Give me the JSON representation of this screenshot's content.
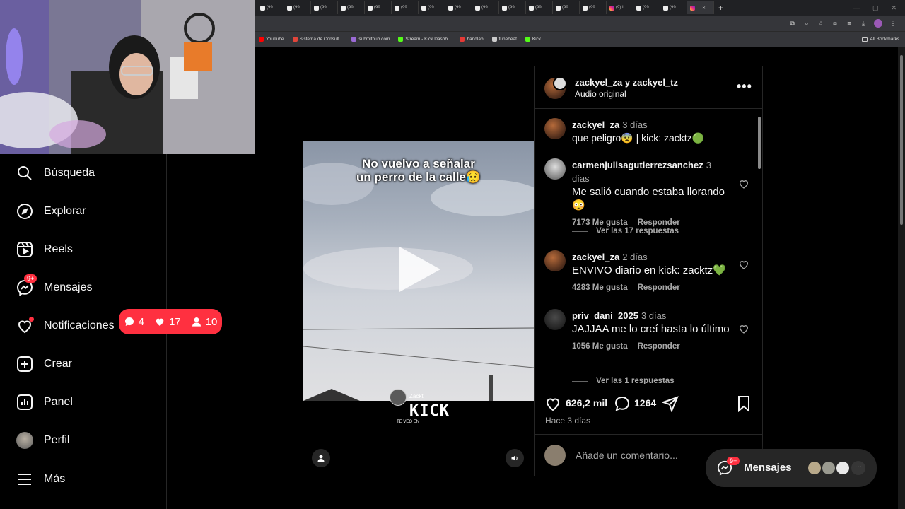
{
  "browser": {
    "tabs": [
      {
        "label": "(99",
        "icon": "tiktok"
      },
      {
        "label": "(99",
        "icon": "tiktok"
      },
      {
        "label": "(99",
        "icon": "tiktok"
      },
      {
        "label": "(99",
        "icon": "tiktok"
      },
      {
        "label": "(99",
        "icon": "tiktok"
      },
      {
        "label": "(99",
        "icon": "tiktok"
      },
      {
        "label": "(99",
        "icon": "tiktok"
      },
      {
        "label": "(99",
        "icon": "tiktok"
      },
      {
        "label": "(99",
        "icon": "tiktok"
      },
      {
        "label": "(99",
        "icon": "tiktok"
      },
      {
        "label": "(99",
        "icon": "tiktok"
      },
      {
        "label": "(99",
        "icon": "tiktok"
      },
      {
        "label": "(99",
        "icon": "tiktok"
      },
      {
        "label": "(9) I",
        "icon": "instagram"
      },
      {
        "label": "(99",
        "icon": "tiktok"
      },
      {
        "label": "(99",
        "icon": "tiktok"
      },
      {
        "label": "",
        "icon": "instagram",
        "active": true
      }
    ],
    "bookmarks": [
      "YouTube",
      "Sistema de Consult...",
      "submithub.com",
      "Stream - Kick Dashb...",
      "bandlab",
      "tunebeat",
      "Kick"
    ],
    "bookmark_colors": [
      "#ff0000",
      "#e0453a",
      "#9b6bd6",
      "#53fc18",
      "#e53935",
      "#cccccc",
      "#53fc18"
    ],
    "all_bookmarks": "All Bookmarks"
  },
  "sidebar": {
    "items": [
      {
        "label": "Búsqueda",
        "icon": "search-icon"
      },
      {
        "label": "Explorar",
        "icon": "compass-icon"
      },
      {
        "label": "Reels",
        "icon": "reels-icon"
      },
      {
        "label": "Mensajes",
        "icon": "messenger-icon",
        "badge": "9+"
      },
      {
        "label": "Notificaciones",
        "icon": "heart-icon"
      },
      {
        "label": "Crear",
        "icon": "plus-square-icon"
      },
      {
        "label": "Panel",
        "icon": "chart-icon"
      },
      {
        "label": "Perfil",
        "icon": "avatar"
      },
      {
        "label": "Más",
        "icon": "menu-icon"
      }
    ]
  },
  "notifications_popup": {
    "comments": "4",
    "likes": "17",
    "followers": "10"
  },
  "video": {
    "caption_line1": "No vuelvo a señalar",
    "caption_line2": "un perro de la calle😥",
    "watermark_name": "Zackt",
    "watermark_logo": "KICK",
    "watermark_sub": "TE VEO EN"
  },
  "post": {
    "header_names": "zackyel_za y zackyel_tz",
    "header_audio": "Audio original",
    "comments": [
      {
        "user": "zackyel_za",
        "time": "3 días",
        "text": "que peligro😨 | kick: zacktz🟢"
      },
      {
        "user": "carmenjulisagutierrezsanchez",
        "time": "3 días",
        "text": "Me salió cuando estaba llorando 😳",
        "likes": "7173 Me gusta",
        "reply": "Responder",
        "replies": "Ver las 17 respuestas"
      },
      {
        "user": "zackyel_za",
        "time": "2 días",
        "text": "ENVIVO diario en kick: zacktz💚",
        "likes": "4283 Me gusta",
        "reply": "Responder"
      },
      {
        "user": "priv_dani_2025",
        "time": "3 días",
        "text": "JAJJAA me lo creí hasta lo último",
        "likes": "1056 Me gusta",
        "reply": "Responder",
        "replies": "Ver las 1 respuestas"
      }
    ],
    "like_count": "626,2 mil",
    "comment_count": "1264",
    "date": "Hace 3 días",
    "comment_placeholder": "Añade un comentario..."
  },
  "messages_popup": {
    "label": "Mensajes",
    "badge": "9+"
  },
  "colors": {
    "accent_red": "#ff3040",
    "bg": "#000000",
    "panel": "#262626"
  }
}
